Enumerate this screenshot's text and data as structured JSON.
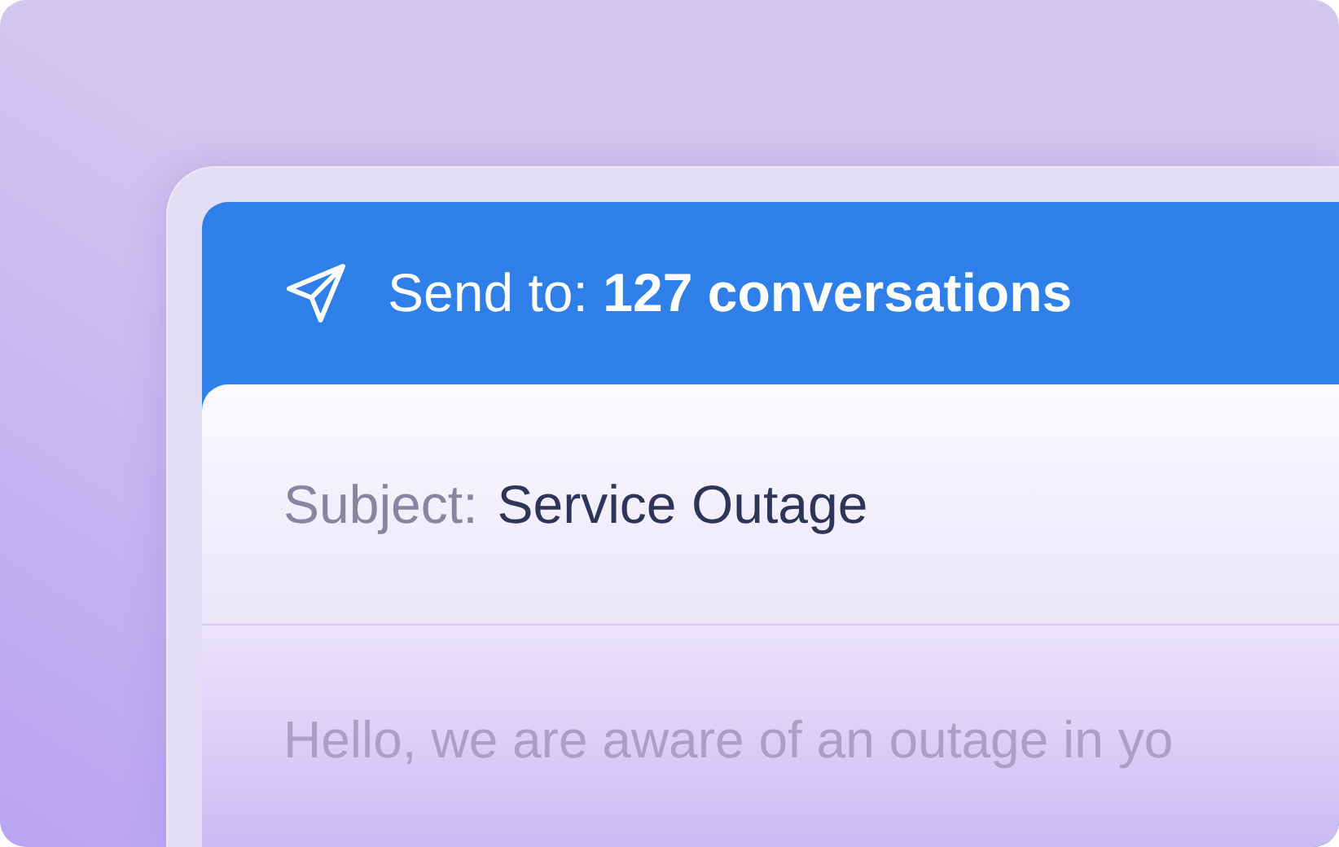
{
  "header": {
    "label": "Send to: **127 conversations**"
  },
  "subject": {
    "label": "Subject:",
    "value": "Service Outage"
  },
  "body": {
    "text": "Hello, we are aware of an outage in yo"
  }
}
